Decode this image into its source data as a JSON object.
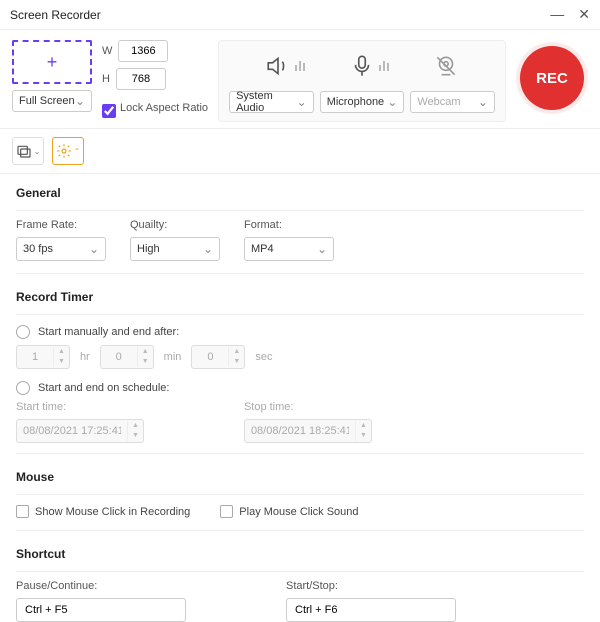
{
  "titlebar": {
    "title": "Screen Recorder"
  },
  "capture": {
    "mode": "Full Screen",
    "width": "1366",
    "height": "768",
    "w_label": "W",
    "h_label": "H",
    "lock_label": "Lock Aspect Ratio"
  },
  "sources": {
    "audio": "System Audio",
    "mic": "Microphone",
    "webcam": "Webcam"
  },
  "rec": {
    "label": "REC"
  },
  "general": {
    "header": "General",
    "frame_rate_label": "Frame Rate:",
    "frame_rate": "30 fps",
    "quality_label": "Quailty:",
    "quality": "High",
    "format_label": "Format:",
    "format": "MP4"
  },
  "timer": {
    "header": "Record Timer",
    "opt1": "Start manually and end after:",
    "opt2": "Start and end on schedule:",
    "hr": "1",
    "hr_unit": "hr",
    "min": "0",
    "min_unit": "min",
    "sec": "0",
    "sec_unit": "sec",
    "start_label": "Start time:",
    "start": "08/08/2021 17:25:41",
    "stop_label": "Stop time:",
    "stop": "08/08/2021 18:25:41"
  },
  "mouse": {
    "header": "Mouse",
    "show_click": "Show Mouse Click in Recording",
    "play_sound": "Play Mouse Click Sound"
  },
  "shortcut": {
    "header": "Shortcut",
    "pause_label": "Pause/Continue:",
    "pause": "Ctrl + F5",
    "startstop_label": "Start/Stop:",
    "startstop": "Ctrl + F6"
  }
}
